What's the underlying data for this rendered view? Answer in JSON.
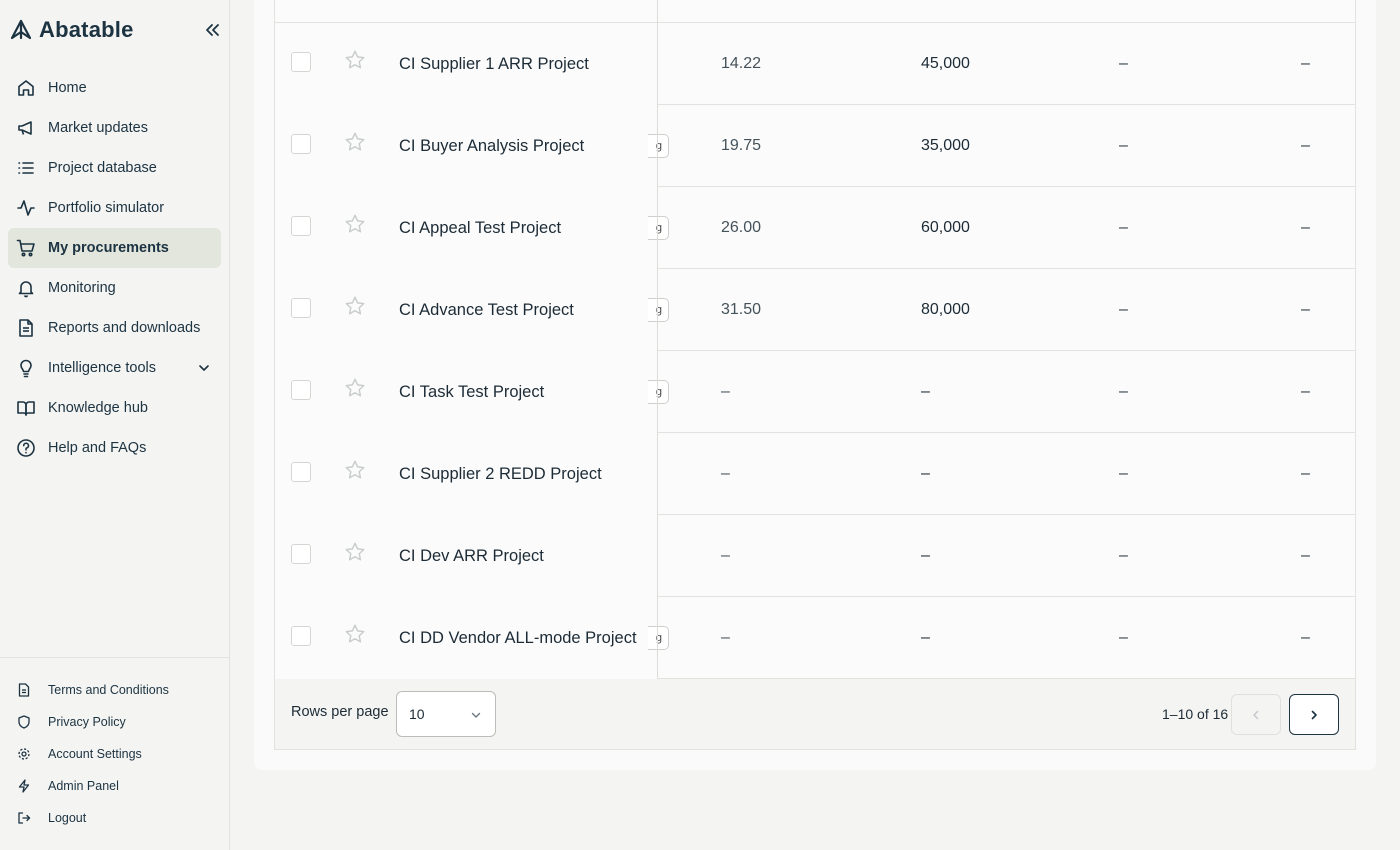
{
  "app": {
    "brand_name": "Abatable",
    "colors": {
      "brand": "#1c3342",
      "active_nav_bg": "#e2e6dd",
      "border": "#e2e2df"
    }
  },
  "sidebar": {
    "collapse_icon": "double-chevron-left-icon",
    "items": [
      {
        "label": "Home",
        "icon": "home-icon",
        "active": false
      },
      {
        "label": "Market updates",
        "icon": "megaphone-icon",
        "active": false
      },
      {
        "label": "Project database",
        "icon": "list-icon",
        "active": false
      },
      {
        "label": "Portfolio simulator",
        "icon": "activity-icon",
        "active": false
      },
      {
        "label": "My procurements",
        "icon": "shopping-cart-icon",
        "active": true
      },
      {
        "label": "Monitoring",
        "icon": "bell-icon",
        "active": false
      },
      {
        "label": "Reports and downloads",
        "icon": "document-icon",
        "active": false
      },
      {
        "label": "Intelligence tools",
        "icon": "lightbulb-icon",
        "active": false,
        "expandable": true
      },
      {
        "label": "Knowledge hub",
        "icon": "book-open-icon",
        "active": false
      },
      {
        "label": "Help and FAQs",
        "icon": "help-circle-icon",
        "active": false
      }
    ],
    "footer_items": [
      {
        "label": "Terms and Conditions",
        "icon": "file-text-icon"
      },
      {
        "label": "Privacy Policy",
        "icon": "shield-icon"
      },
      {
        "label": "Account Settings",
        "icon": "gear-icon"
      },
      {
        "label": "Admin Panel",
        "icon": "lightning-icon"
      },
      {
        "label": "Logout",
        "icon": "logout-icon"
      }
    ]
  },
  "table": {
    "rows": [
      {
        "name": "CI Supplier 1 ARR Project",
        "tag_stub": "",
        "col1": "14.22",
        "col2": "45,000",
        "col3": "–",
        "col4": "–",
        "starred": false
      },
      {
        "name": "CI Buyer Analysis Project",
        "tag_stub": "g",
        "col1": "19.75",
        "col2": "35,000",
        "col3": "–",
        "col4": "–",
        "starred": false
      },
      {
        "name": "CI Appeal Test Project",
        "tag_stub": "g",
        "col1": "26.00",
        "col2": "60,000",
        "col3": "–",
        "col4": "–",
        "starred": false
      },
      {
        "name": "CI Advance Test Project",
        "tag_stub": "g",
        "col1": "31.50",
        "col2": "80,000",
        "col3": "–",
        "col4": "–",
        "starred": false
      },
      {
        "name": "CI Task Test Project",
        "tag_stub": "g",
        "col1": "–",
        "col2": "–",
        "col3": "–",
        "col4": "–",
        "starred": false
      },
      {
        "name": "CI Supplier 2 REDD Project",
        "tag_stub": "",
        "col1": "–",
        "col2": "–",
        "col3": "–",
        "col4": "–",
        "starred": false
      },
      {
        "name": "CI Dev ARR Project",
        "tag_stub": "",
        "col1": "–",
        "col2": "–",
        "col3": "–",
        "col4": "–",
        "starred": false
      },
      {
        "name": "CI DD Vendor ALL-mode Project",
        "tag_stub": "g",
        "col1": "–",
        "col2": "–",
        "col3": "–",
        "col4": "–",
        "starred": false
      }
    ]
  },
  "pagination": {
    "rows_per_page_label": "Rows per page",
    "rows_per_page_value": "10",
    "range_text": "1–10 of 16",
    "prev_enabled": false,
    "next_enabled": true
  }
}
